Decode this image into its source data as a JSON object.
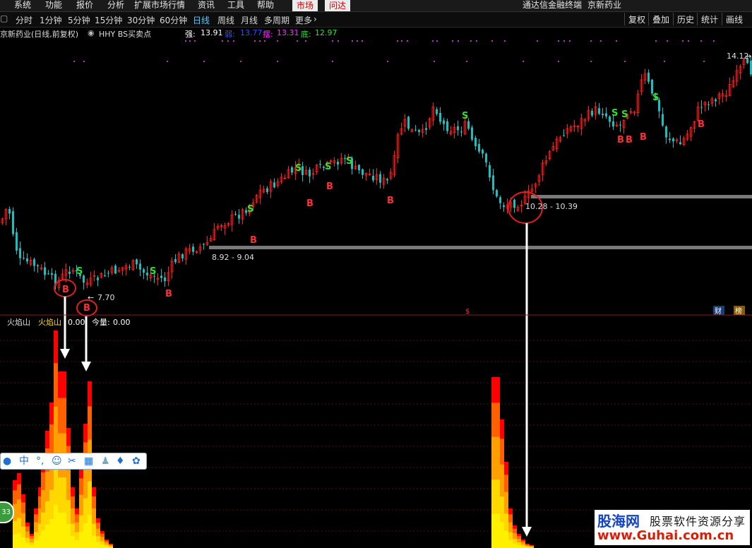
{
  "menu": {
    "items": [
      "系统",
      "功能",
      "报价",
      "分析",
      "扩展市场行情",
      "资讯",
      "工具",
      "帮助"
    ],
    "active": "市场",
    "wenda": "问达",
    "center_title": "通达信金融终端",
    "stock": "京新药业"
  },
  "tabs": {
    "periods": [
      "分时",
      "1分钟",
      "5分钟",
      "15分钟",
      "30分钟",
      "60分钟",
      "日线",
      "周线",
      "月线",
      "多周期",
      "更多"
    ],
    "active": "日线",
    "right_buttons": [
      "复权",
      "叠加",
      "历史",
      "统计",
      "画线"
    ]
  },
  "info": {
    "title": "京新药业(日线,前复权)",
    "indicator": "HHY BS买卖点",
    "strong_label": "强:",
    "strong_value": "13.91",
    "weak_label": "弱:",
    "weak_value": "13.77",
    "swing_label": "摆:",
    "swing_value": "13.31",
    "bottom_label": "底:",
    "bottom_value": "12.97"
  },
  "chart_data": {
    "type": "candlestick",
    "price_max_label": "14.12",
    "low_label": "7.70",
    "support_zone_1": "8.92 - 9.04",
    "support_zone_2": "10.28 - 10.39",
    "buy_signals": [
      "B",
      "B",
      "B",
      "B",
      "B",
      "B",
      "B",
      "B",
      "B",
      "B"
    ],
    "sell_signals": [
      "S",
      "S",
      "S",
      "S",
      "S",
      "S",
      "S",
      "S",
      "S"
    ],
    "signal_letters": {
      "buy": "B",
      "sell": "S"
    },
    "colors": {
      "up": "#ff2020",
      "down": "#19c0c0",
      "buy": "#ff3030",
      "sell": "#30e030",
      "band": "#7a7a7a",
      "arrow": "#ffffff",
      "circle": "#e02020"
    },
    "lower_indicator": {
      "name": "火焰山",
      "label": "火焰山",
      "value": "0.00",
      "volume_label": "今量:",
      "volume_value": "0.00",
      "colors": [
        "#ff0000",
        "#ff6000",
        "#ffa000",
        "#ffd800",
        "#fff000"
      ]
    },
    "side_tags": {
      "cai": "财",
      "bang": "榜"
    }
  },
  "toolbar": {
    "icons": [
      "user-icon",
      "中",
      "dot-icon",
      "smile-icon",
      "scissors-icon",
      "keyboard-icon",
      "person-icon",
      "shirt-icon",
      "gear-icon"
    ],
    "zhong": "中"
  },
  "badge": "33",
  "watermark": {
    "logo": "股海网",
    "slogan": "股票软件资源分享",
    "url": "www.Guhai.com.cn"
  }
}
